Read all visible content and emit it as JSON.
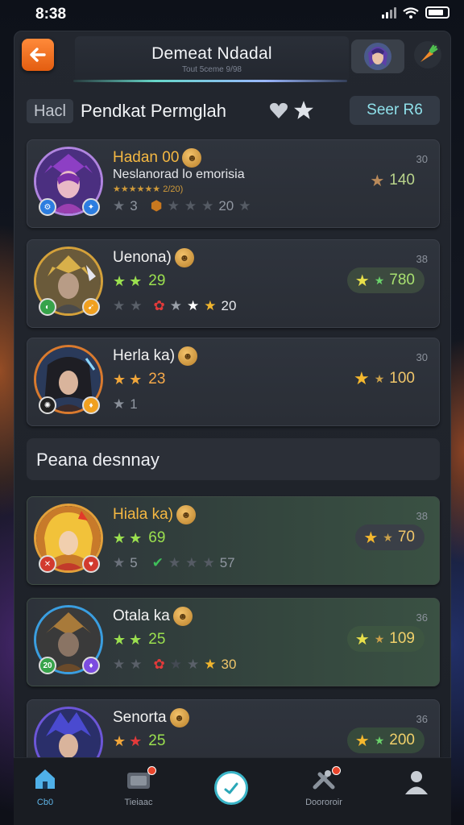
{
  "status_bar": {
    "time": "8:38"
  },
  "header": {
    "title": "Demeat Ndadal",
    "subtitle": "Tout 5ceme 9/98"
  },
  "section": {
    "tag": "Hacl",
    "title": "Pendkat Permglah",
    "view_button": "Seer R6"
  },
  "cards_top": [
    {
      "name": "Hadan 00",
      "name_style": "gold",
      "description": "Neslanorad lo emorisia",
      "mini_rating": "★★★★★★ 2/20)",
      "row3_left": "3",
      "row3_right": "20",
      "corner": "30",
      "score": "140",
      "score_style": "plain",
      "border": "#b084e0",
      "badges": [
        "#2c7de0",
        "#2c7de0"
      ]
    },
    {
      "name": "Uenona)",
      "name_style": "white",
      "level": "29",
      "level_style": "green",
      "row3_right": "20",
      "corner": "38",
      "score": "780",
      "score_style": "pill",
      "border": "#d4a13a",
      "badges": [
        "#37a34a",
        "#f0a020"
      ]
    },
    {
      "name": "Herla ka)",
      "name_style": "white",
      "level": "23",
      "level_style": "orange",
      "row3_left": "1",
      "corner": "30",
      "score": "100",
      "score_style": "plain-gold",
      "border": "#d97a2e",
      "badges": [
        "#222222",
        "#f0a020"
      ]
    }
  ],
  "divider": {
    "label": "Peana desnnay"
  },
  "cards_bottom": [
    {
      "name": "Hiala ka)",
      "name_style": "gold",
      "level": "69",
      "level_style": "green",
      "row3_left": "5",
      "row3_right": "57",
      "corner": "38",
      "score": "70",
      "score_style": "pill-dark",
      "border": "#e3a03a",
      "badges": [
        "#d23a2e",
        "#d23a2e"
      ]
    },
    {
      "name": "Otala ka",
      "name_style": "white",
      "level": "25",
      "level_style": "green",
      "row3_right": "30",
      "corner": "36",
      "score": "109",
      "score_style": "pill-green",
      "border": "#3a9ee0",
      "badges": [
        "#37a34a",
        "#7c4ce0"
      ]
    },
    {
      "name": "Senorta",
      "name_style": "white",
      "level": "25",
      "level_style": "orange",
      "corner": "36",
      "score": "200",
      "score_style": "pill-green",
      "border": "#6c56d8",
      "badges": []
    }
  ],
  "nav": {
    "home_label": "Cb0",
    "tab2_label": "Tieiaac",
    "tab4_label": "Doororoir"
  },
  "colors": {
    "accent_orange": "#f07a24",
    "accent_teal": "#5fd3d8",
    "score_green": "#a8e070",
    "gold": "#f5b842"
  }
}
